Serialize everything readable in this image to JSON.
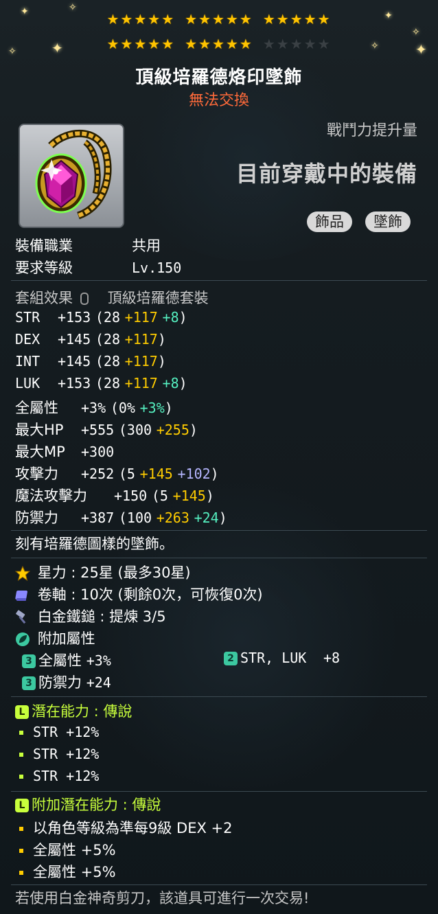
{
  "title": "頂級培羅德烙印墜飾",
  "trade_status": "無法交換",
  "combat_power": {
    "label": "戰鬥力提升量",
    "value": "目前穿戴中的裝備"
  },
  "tags": [
    "飾品",
    "墜飾"
  ],
  "star_rows": [
    {
      "filled": 15,
      "total": 15
    },
    {
      "filled": 10,
      "total": 15
    }
  ],
  "info": {
    "job_label": "裝備職業",
    "job_value": "共用",
    "level_label": "要求等級",
    "level_value": "Lv.150"
  },
  "set": {
    "label": "套組效果",
    "value": "頂級培羅德套裝"
  },
  "stats": [
    {
      "name": "STR",
      "total": "+153",
      "base": "(28",
      "bonus1": "+117",
      "bonus2": "+8",
      "bonus2_color": "green",
      "close": ")"
    },
    {
      "name": "DEX",
      "total": "+145",
      "base": "(28",
      "bonus1": "+117",
      "bonus2": "",
      "bonus2_color": "",
      "close": ")"
    },
    {
      "name": "INT",
      "total": "+145",
      "base": "(28",
      "bonus1": "+117",
      "bonus2": "",
      "bonus2_color": "",
      "close": ")"
    },
    {
      "name": "LUK",
      "total": "+153",
      "base": "(28",
      "bonus1": "+117",
      "bonus2": "+8",
      "bonus2_color": "green",
      "close": ")"
    },
    {
      "name": "全屬性",
      "total": "+3%",
      "base": "(0%",
      "bonus1": "",
      "bonus2": "+3%",
      "bonus2_color": "green",
      "close": ")"
    },
    {
      "name": "最大HP",
      "total": "+555",
      "base": "(300",
      "bonus1": "+255",
      "bonus2": "",
      "bonus2_color": "",
      "close": ")"
    },
    {
      "name": "最大MP",
      "total": "+300",
      "base": "",
      "bonus1": "",
      "bonus2": "",
      "bonus2_color": "",
      "close": ""
    },
    {
      "name": "攻擊力",
      "total": "+252",
      "base": "(5",
      "bonus1": "+145",
      "bonus2": "+102",
      "bonus2_color": "lav",
      "close": ")"
    },
    {
      "name": "魔法攻擊力",
      "total": "+150",
      "base": "(5",
      "bonus1": "+145",
      "bonus2": "",
      "bonus2_color": "",
      "close": ")"
    },
    {
      "name": "防禦力",
      "total": "+387",
      "base": "(100",
      "bonus1": "+263",
      "bonus2": "+24",
      "bonus2_color": "green",
      "close": ")"
    }
  ],
  "description": "刻有培羅德圖樣的墜飾。",
  "star_force": {
    "label": "星力",
    "value": "25星 (最多30星)"
  },
  "scroll": {
    "label": "卷軸",
    "value": "10次 (剩餘0次，可恢復0次)"
  },
  "platinum": {
    "label": "白金鐵鎚",
    "value": "提煉 3/5"
  },
  "additional": {
    "label": "附加屬性",
    "items": [
      {
        "badge": "3",
        "name": "全屬性",
        "value": "+3%"
      },
      {
        "badge": "2",
        "name": "STR, LUK",
        "value": "+8"
      },
      {
        "badge": "3",
        "name": "防禦力",
        "value": "+24"
      }
    ]
  },
  "potential": {
    "badge": "L",
    "label": "潛在能力 : 傳說",
    "lines": [
      "STR +12%",
      "STR +12%",
      "STR +12%"
    ]
  },
  "bonus_potential": {
    "badge": "L",
    "label": "附加潛在能力 : 傳說",
    "lines": [
      "以角色等級為準每9級 DEX +2",
      "全屬性 +5%",
      "全屬性 +5%"
    ]
  },
  "footer": "若使用白金神奇剪刀，該道具可進行一次交易!",
  "colors": {
    "title": "#ffffff",
    "trade": "#ff6a3a",
    "star_filled": "#ffc400",
    "star_empty": "#3a4044",
    "bonus_yellow": "#ffcc00",
    "bonus_green": "#55f0c0",
    "bonus_lavender": "#b6b6ff",
    "legendary": "#c8ff3c"
  },
  "icons": [
    "star-icon",
    "scroll-icon",
    "hammer-icon",
    "leaf-icon"
  ]
}
